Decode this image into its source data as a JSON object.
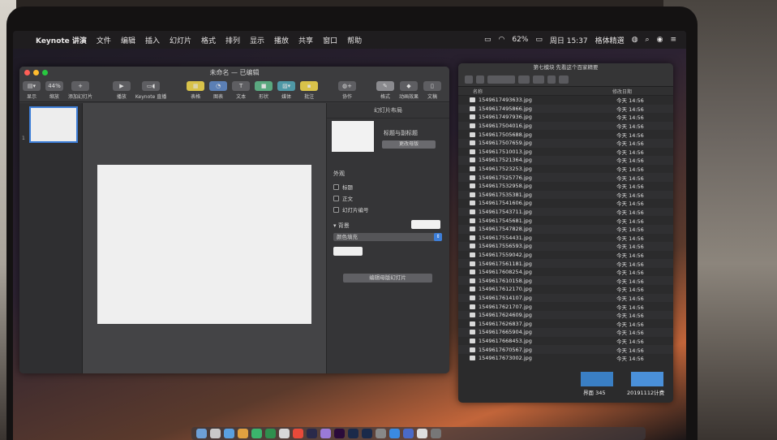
{
  "menubar": {
    "app_name": "Keynote 讲演",
    "menus": [
      "文件",
      "编辑",
      "插入",
      "幻灯片",
      "格式",
      "排列",
      "显示",
      "播放",
      "共享",
      "窗口",
      "帮助"
    ],
    "battery": "62%",
    "clock": "周日 15:37",
    "status_app": "格体精選"
  },
  "keynote": {
    "title": "未命名 — 已编辑",
    "toolbar": {
      "view_label": "显示",
      "zoom_value": "44%",
      "zoom_label": "缩放",
      "add_slide_label": "添加幻灯片",
      "play_label": "播放",
      "keynote_live_label": "Keynote 直播",
      "table_label": "表格",
      "chart_label": "图表",
      "text_label": "文本",
      "shape_label": "形状",
      "media_label": "媒体",
      "comment_label": "批注",
      "collaborate_label": "协作",
      "format_label": "格式",
      "animate_label": "动画效果",
      "document_label": "文稿"
    },
    "navigator": {
      "slide_number": "1"
    },
    "inspector": {
      "title": "幻灯片布局",
      "layout_name": "标题与副标题",
      "change_master_label": "更改母版",
      "appearance_title": "外观",
      "checkbox_title": "标题",
      "checkbox_body": "正文",
      "checkbox_slide_number": "幻灯片编号",
      "background_title": "背景",
      "fill_option": "颜色填充",
      "reset_button": "编辑母版幻灯片"
    }
  },
  "finder": {
    "title": "第七模块 先看这个百家精要",
    "col_name": "名称",
    "col_date": "修改日期",
    "files": [
      {
        "name": "1549617493633.jpg",
        "date": "今天 14:56"
      },
      {
        "name": "1549617495866.jpg",
        "date": "今天 14:56"
      },
      {
        "name": "1549617497936.jpg",
        "date": "今天 14:56"
      },
      {
        "name": "1549617504016.jpg",
        "date": "今天 14:56"
      },
      {
        "name": "1549617505688.jpg",
        "date": "今天 14:56"
      },
      {
        "name": "1549617507659.jpg",
        "date": "今天 14:56"
      },
      {
        "name": "1549617510013.jpg",
        "date": "今天 14:56"
      },
      {
        "name": "1549617521364.jpg",
        "date": "今天 14:56"
      },
      {
        "name": "1549617523253.jpg",
        "date": "今天 14:56"
      },
      {
        "name": "1549617525776.jpg",
        "date": "今天 14:56"
      },
      {
        "name": "1549617532958.jpg",
        "date": "今天 14:56"
      },
      {
        "name": "1549617535381.jpg",
        "date": "今天 14:56"
      },
      {
        "name": "1549617541606.jpg",
        "date": "今天 14:56"
      },
      {
        "name": "1549617543711.jpg",
        "date": "今天 14:56"
      },
      {
        "name": "1549617545681.jpg",
        "date": "今天 14:56"
      },
      {
        "name": "1549617547828.jpg",
        "date": "今天 14:56"
      },
      {
        "name": "1549617554431.jpg",
        "date": "今天 14:56"
      },
      {
        "name": "1549617556593.jpg",
        "date": "今天 14:56"
      },
      {
        "name": "1549617559042.jpg",
        "date": "今天 14:56"
      },
      {
        "name": "1549617561181.jpg",
        "date": "今天 14:56"
      },
      {
        "name": "1549617608254.jpg",
        "date": "今天 14:56"
      },
      {
        "name": "1549617610158.jpg",
        "date": "今天 14:56"
      },
      {
        "name": "1549617612170.jpg",
        "date": "今天 14:56"
      },
      {
        "name": "1549617614107.jpg",
        "date": "今天 14:56"
      },
      {
        "name": "1549617621707.jpg",
        "date": "今天 14:56"
      },
      {
        "name": "1549617624609.jpg",
        "date": "今天 14:56"
      },
      {
        "name": "1549617626837.jpg",
        "date": "今天 14:56"
      },
      {
        "name": "1549617665904.jpg",
        "date": "今天 14:56"
      },
      {
        "name": "1549617668453.jpg",
        "date": "今天 14:56"
      },
      {
        "name": "1549617670567.jpg",
        "date": "今天 14:56"
      },
      {
        "name": "1549617673002.jpg",
        "date": "今天 14:56"
      }
    ]
  },
  "desktop": {
    "item1_label": "界面 345",
    "item2_label": "20191112计费"
  }
}
